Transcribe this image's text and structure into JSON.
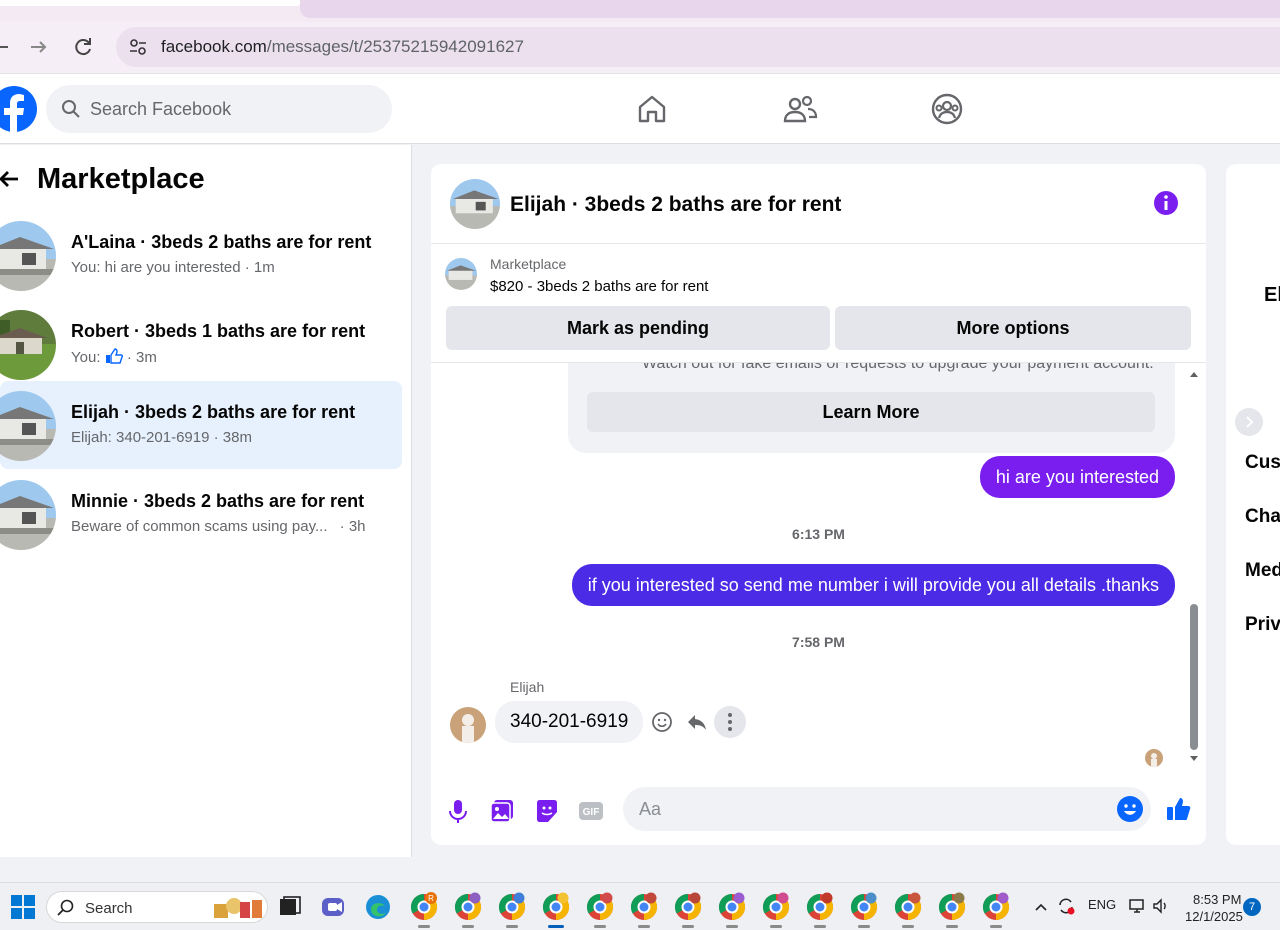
{
  "browser": {
    "url_domain": "facebook.com",
    "url_path": "/messages/t/25375215942091627"
  },
  "header": {
    "search_placeholder": "Search Facebook"
  },
  "sidebar": {
    "title": "Marketplace",
    "conversations": [
      {
        "name": "A'Laina · 3beds 2 baths are for rent",
        "snippet": "You: hi are you interested · 1m",
        "active": false
      },
      {
        "name": "Robert · 3beds 1 baths are for rent",
        "snippet_prefix": "You:",
        "snippet_suffix": "· 3m",
        "active": false
      },
      {
        "name": "Elijah · 3beds 2 baths are for rent",
        "snippet": "Elijah: 340-201-6919 · 38m",
        "active": true
      },
      {
        "name": "Minnie · 3beds 2 baths are for rent",
        "snippet": "Beware of common scams using pay...",
        "snippet_time": "· 3h",
        "active": false
      }
    ]
  },
  "chat": {
    "title": "Elijah · 3beds 2 baths are for rent",
    "listing": {
      "source": "Marketplace",
      "price_title": "$820 - 3beds 2 baths are for rent",
      "mark_pending": "Mark as pending",
      "more_options": "More options"
    },
    "scam_card": {
      "warning": "Watch out for fake emails or requests to upgrade your payment account.",
      "learn_more": "Learn More"
    },
    "messages": {
      "out1": "hi are you interested",
      "time1": "6:13 PM",
      "out2": "if you interested so send me number i will provide you all details .thanks",
      "time2": "7:58 PM",
      "sender": "Elijah",
      "in1": "340-201-6919"
    },
    "composer_placeholder": "Aa",
    "accent": "#7a1ef0",
    "accent_blue": "#4c2be6",
    "fb_blue": "#0866ff"
  },
  "rightpanel": {
    "name": "El",
    "items": [
      "Cust",
      "Chat",
      "Med",
      "Priva"
    ]
  },
  "taskbar": {
    "search_label": "Search",
    "lang": "ENG",
    "time": "8:53 PM",
    "date": "12/1/2025",
    "notifications": "7",
    "chrome_badge": "R"
  }
}
